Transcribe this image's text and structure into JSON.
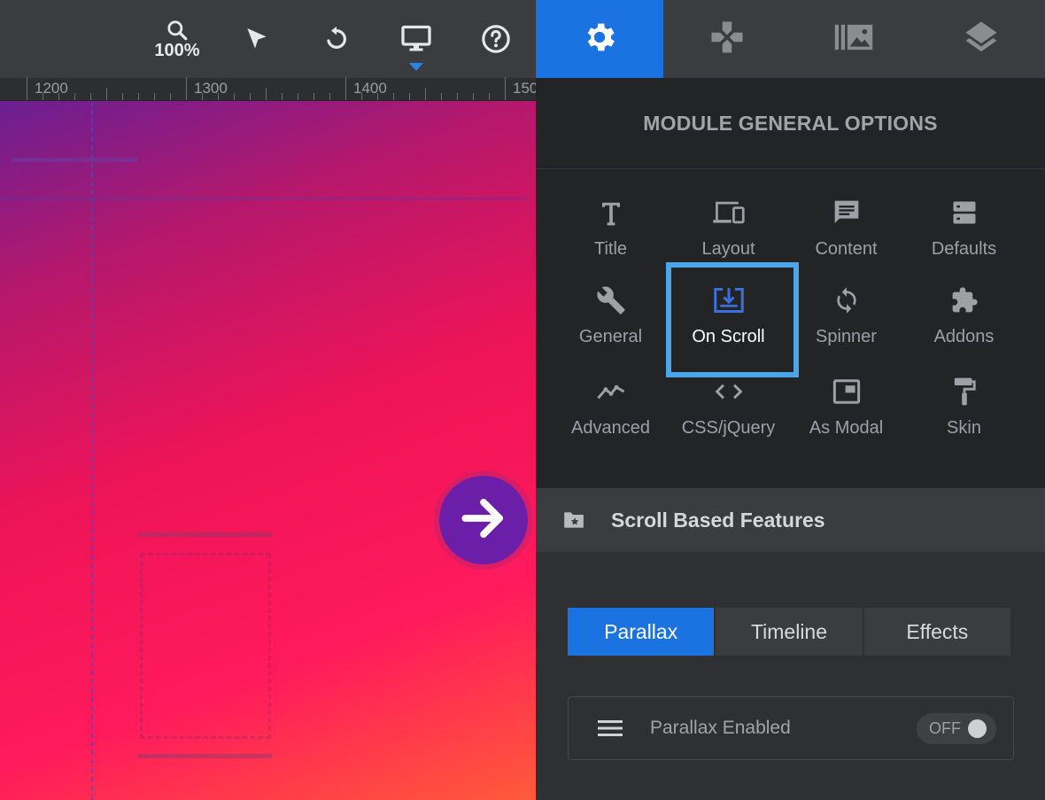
{
  "toolbar": {
    "zoom_label": "100%",
    "tools": [
      {
        "name": "zoom",
        "icon": "search-icon"
      },
      {
        "name": "select",
        "icon": "cursor-arrow-icon"
      },
      {
        "name": "undo",
        "icon": "undo-icon"
      },
      {
        "name": "device",
        "icon": "desktop-monitor-icon",
        "active": true
      },
      {
        "name": "help",
        "icon": "help-circle-icon"
      }
    ]
  },
  "ruler": {
    "labels": [
      "1200",
      "1300",
      "1400",
      "150"
    ]
  },
  "panel_tabs": [
    {
      "name": "settings",
      "icon": "gear-icon",
      "active": true
    },
    {
      "name": "navigation",
      "icon": "gamepad-icon"
    },
    {
      "name": "slides",
      "icon": "slides-library-icon"
    },
    {
      "name": "layers",
      "icon": "layers-icon"
    }
  ],
  "panel": {
    "title": "MODULE GENERAL OPTIONS",
    "options": [
      {
        "label": "Title",
        "icon": "title-t-icon"
      },
      {
        "label": "Layout",
        "icon": "devices-icon"
      },
      {
        "label": "Content",
        "icon": "chat-message-icon"
      },
      {
        "label": "Defaults",
        "icon": "storage-icon"
      },
      {
        "label": "General",
        "icon": "wrench-icon"
      },
      {
        "label": "On Scroll",
        "icon": "scroll-download-icon",
        "selected": true
      },
      {
        "label": "Spinner",
        "icon": "sync-icon"
      },
      {
        "label": "Addons",
        "icon": "puzzle-icon"
      },
      {
        "label": "Advanced",
        "icon": "trend-line-icon"
      },
      {
        "label": "CSS/jQuery",
        "icon": "code-brackets-icon"
      },
      {
        "label": "As Modal",
        "icon": "modal-window-icon"
      },
      {
        "label": "Skin",
        "icon": "paint-roller-icon"
      }
    ],
    "section": {
      "title": "Scroll Based Features",
      "icon": "folder-star-icon"
    },
    "sub_tabs": [
      {
        "label": "Parallax",
        "active": true
      },
      {
        "label": "Timeline"
      },
      {
        "label": "Effects"
      }
    ],
    "parallax_row": {
      "label": "Parallax Enabled",
      "icon": "menu-lines-icon",
      "toggle_state": "OFF"
    }
  },
  "colors": {
    "accent_blue": "#1a73e0",
    "selection_frame": "#4ba6ea",
    "panel_bg": "#232426",
    "toolbar_bg": "#3a3c40",
    "arrow_button": "#6b1fa8"
  }
}
